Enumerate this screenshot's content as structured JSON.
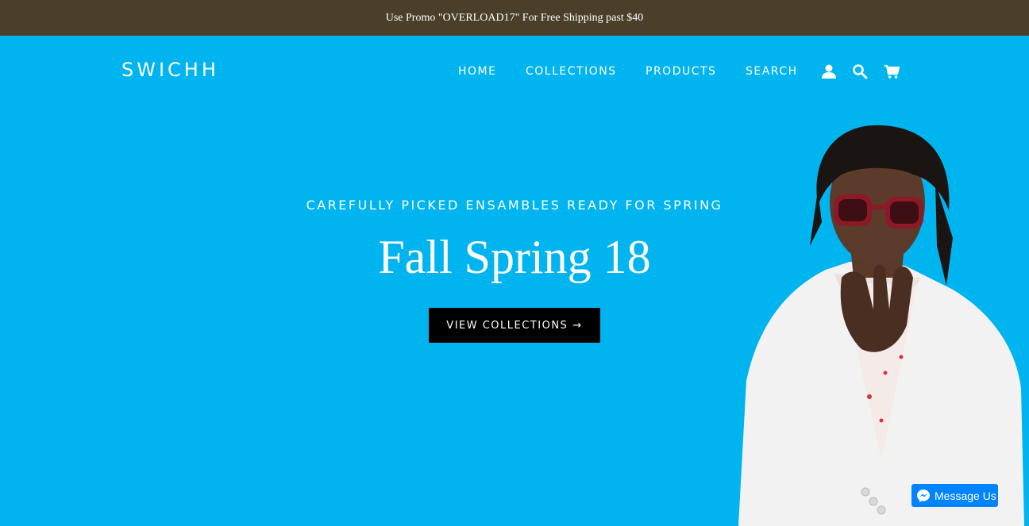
{
  "announcement": {
    "text": "Use Promo \"OVERLOAD17\" For Free Shipping past $40"
  },
  "header": {
    "logo": "SWICHH",
    "nav": [
      {
        "label": "HOME"
      },
      {
        "label": "COLLECTIONS"
      },
      {
        "label": "PRODUCTS"
      },
      {
        "label": "SEARCH"
      }
    ],
    "icons": [
      "account-icon",
      "search-icon",
      "cart-icon"
    ]
  },
  "hero": {
    "subtitle": "CAREFULLY PICKED ENSAMBLES READY FOR SPRING",
    "title": "Fall Spring 18",
    "button_label": "VIEW COLLECTIONS",
    "button_arrow": "→"
  },
  "messenger": {
    "label": "Message Us"
  },
  "colors": {
    "background": "#00b4ef",
    "announcement_bar": "#4c3f2a",
    "button": "#000000",
    "messenger": "#0084ff"
  }
}
